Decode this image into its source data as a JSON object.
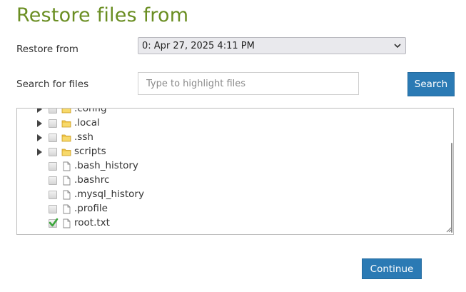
{
  "title": "Restore files from",
  "restore_from": {
    "label": "Restore from",
    "selected": "0: Apr 27, 2025 4:11 PM"
  },
  "search": {
    "label": "Search for files",
    "placeholder": "Type to highlight files",
    "value": "",
    "button": "Search"
  },
  "tree": {
    "items": [
      {
        "name": ".config",
        "type": "folder",
        "checked": false
      },
      {
        "name": ".local",
        "type": "folder",
        "checked": false
      },
      {
        "name": ".ssh",
        "type": "folder",
        "checked": false
      },
      {
        "name": "scripts",
        "type": "folder",
        "checked": false
      },
      {
        "name": ".bash_history",
        "type": "file",
        "checked": false
      },
      {
        "name": ".bashrc",
        "type": "file",
        "checked": false
      },
      {
        "name": ".mysql_history",
        "type": "file",
        "checked": false
      },
      {
        "name": ".profile",
        "type": "file",
        "checked": false
      },
      {
        "name": "root.txt",
        "type": "file",
        "checked": true
      }
    ]
  },
  "continue_button": "Continue",
  "colors": {
    "title": "#6a8e22",
    "button": "#2b7ab4",
    "check": "#3ca63c",
    "folder": "#f0c64a"
  }
}
